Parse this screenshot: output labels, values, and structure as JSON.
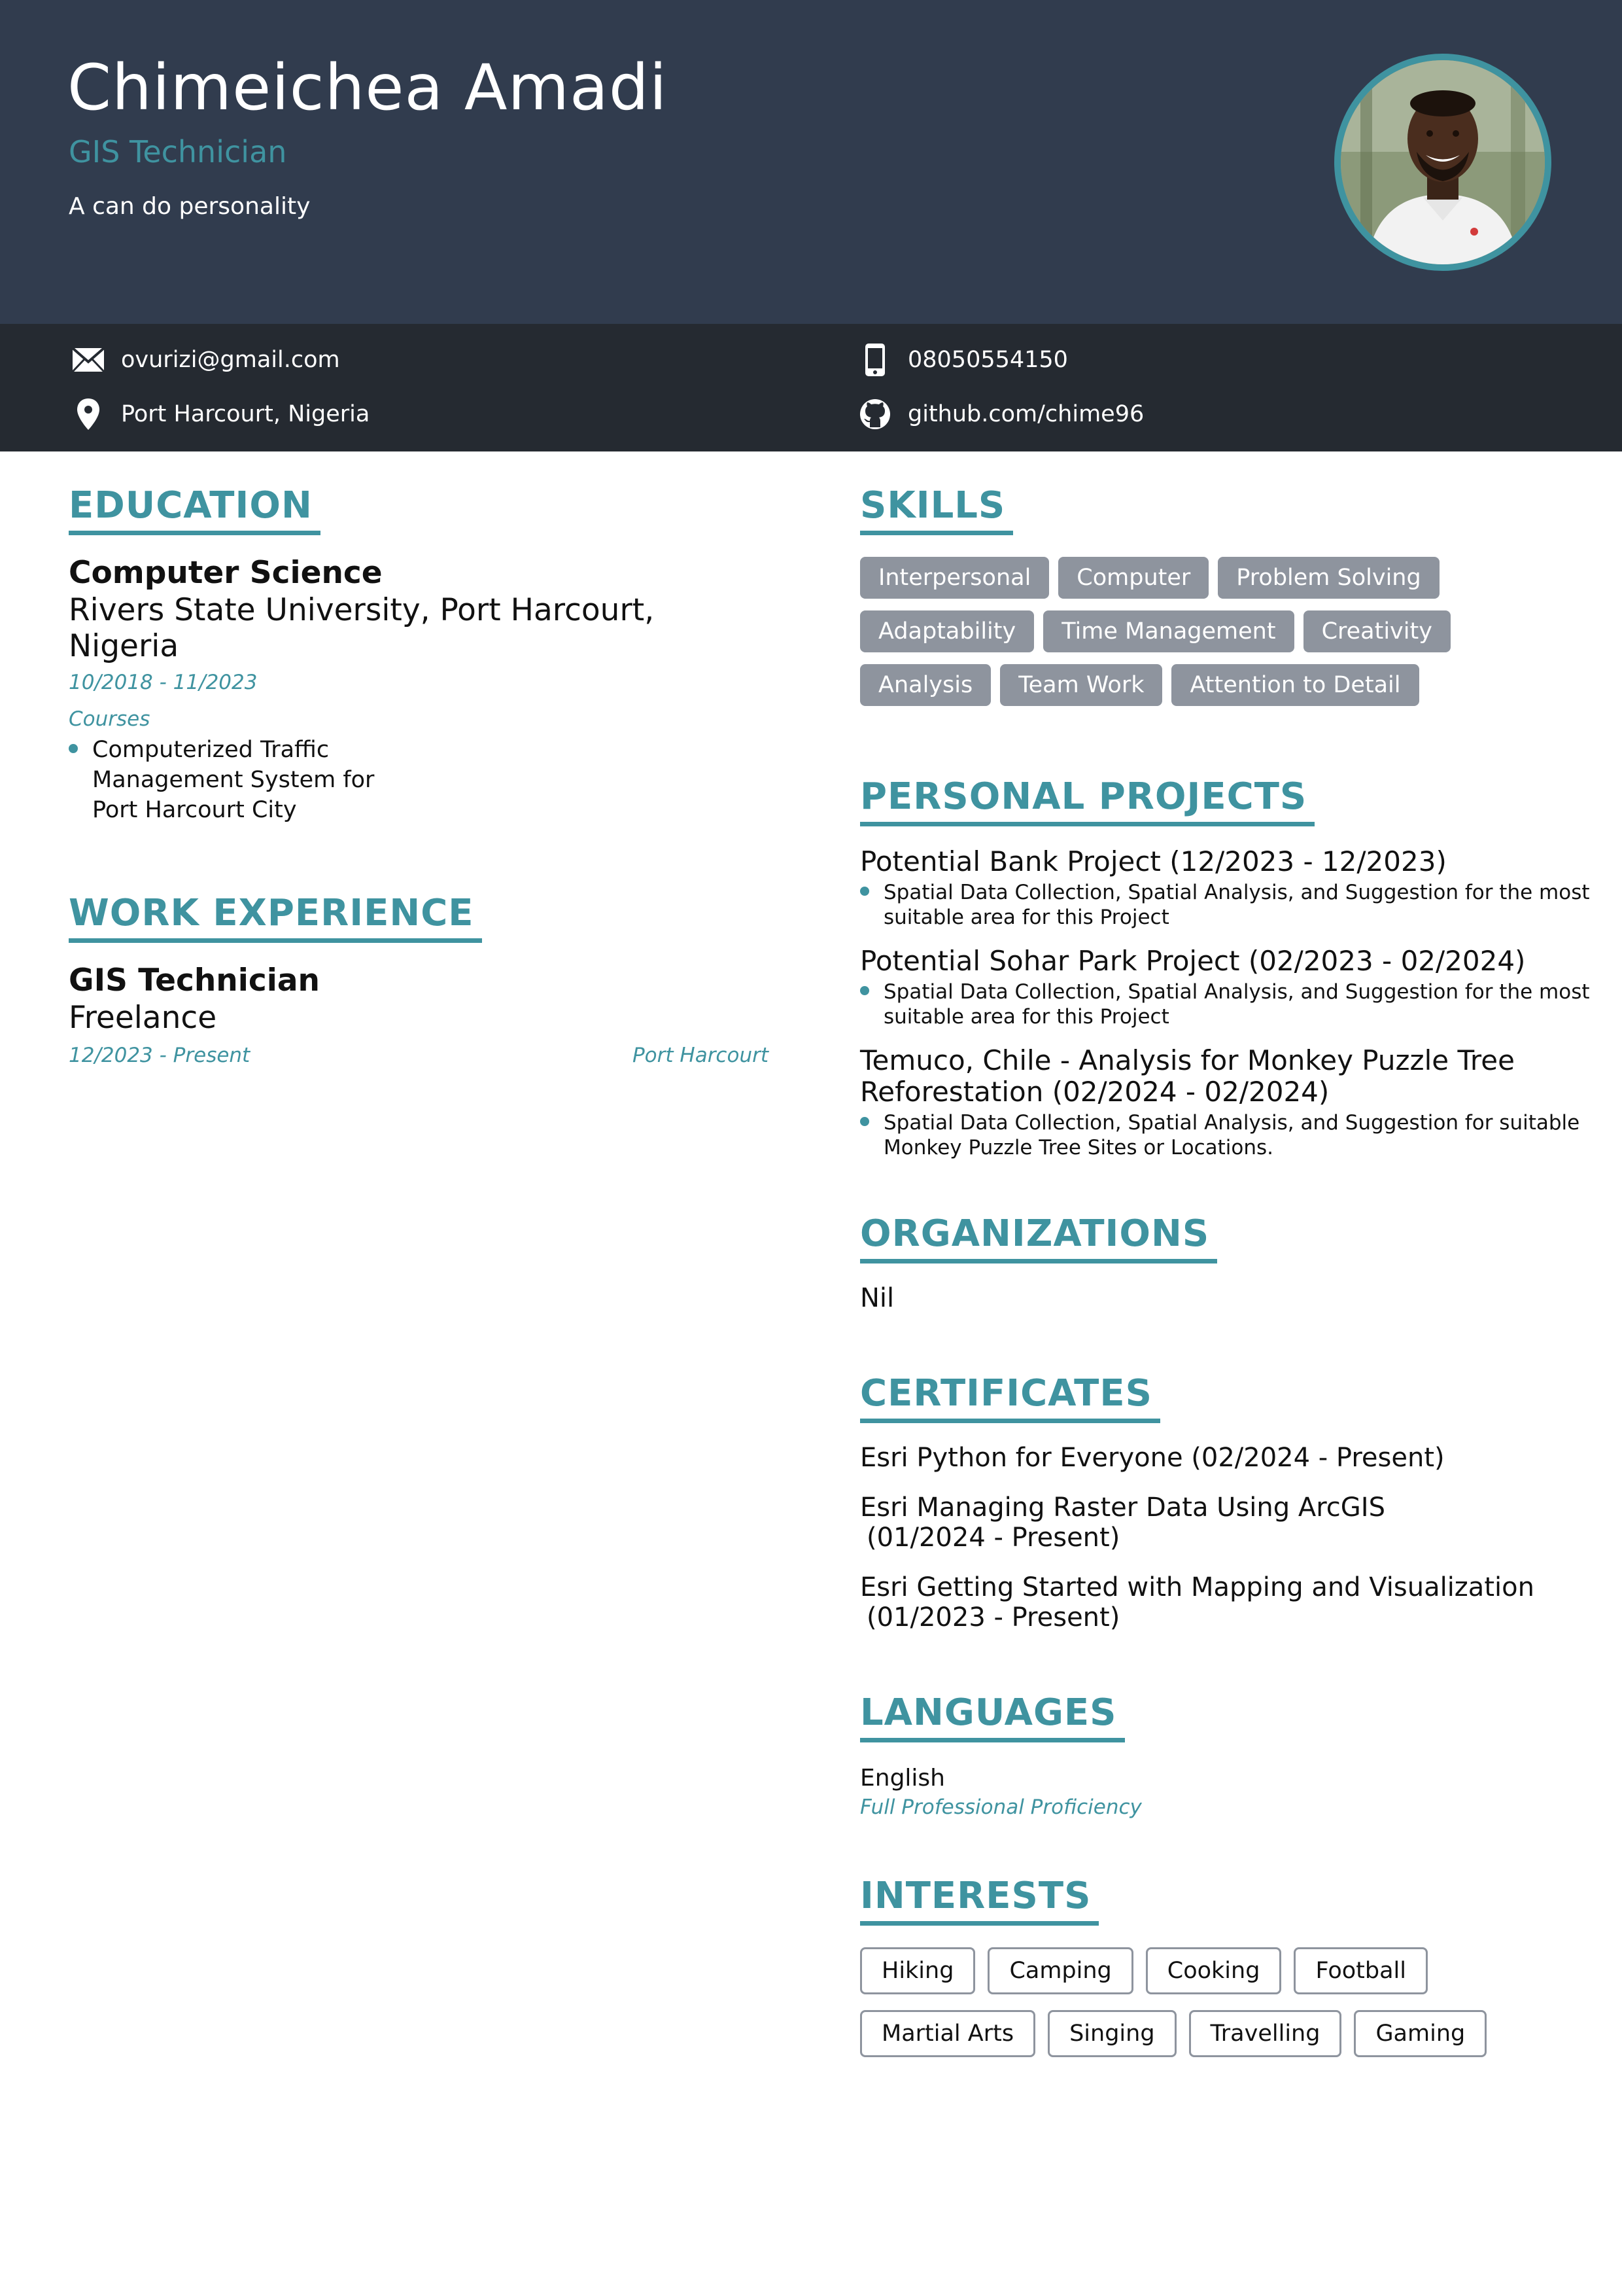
{
  "header": {
    "name": "Chimeichea Amadi",
    "role": "GIS Technician",
    "tagline": "A can do personality"
  },
  "contact": {
    "email": "ovurizi@gmail.com",
    "location": "Port Harcourt, Nigeria",
    "phone": "08050554150",
    "github": "github.com/chime96"
  },
  "education": {
    "title": "EDUCATION",
    "degree": "Computer Science",
    "school": "Rivers State University, Port Harcourt, Nigeria",
    "dates": "10/2018 - 11/2023",
    "courses_label": "Courses",
    "courses": [
      "Computerized Traffic Management System for Port Harcourt City"
    ]
  },
  "work": {
    "title": "WORK EXPERIENCE",
    "role": "GIS Technician",
    "company": "Freelance",
    "dates": "12/2023 - Present",
    "location": "Port Harcourt"
  },
  "skills": {
    "title": "SKILLS",
    "items": [
      "Interpersonal",
      "Computer",
      "Problem Solving",
      "Adaptability",
      "Time Management",
      "Creativity",
      "Analysis",
      "Team Work",
      "Attention to Detail"
    ]
  },
  "projects": {
    "title": "PERSONAL PROJECTS",
    "items": [
      {
        "name": "Potential Bank Project (12/2023 - 12/2023)",
        "desc": "Spatial Data Collection, Spatial Analysis, and Suggestion for the most suitable area for this Project"
      },
      {
        "name": "Potential Sohar Park Project (02/2023 - 02/2024)",
        "desc": "Spatial Data Collection, Spatial Analysis, and Suggestion for the most suitable area for this Project"
      },
      {
        "name": "Temuco, Chile - Analysis for Monkey Puzzle Tree Reforestation (02/2024 - 02/2024)",
        "desc": "Spatial Data Collection, Spatial Analysis, and Suggestion for suitable Monkey Puzzle Tree Sites or Locations."
      }
    ]
  },
  "organizations": {
    "title": "ORGANIZATIONS",
    "text": "Nil"
  },
  "certificates": {
    "title": "CERTIFICATES",
    "items": [
      {
        "line1": "Esri Python for Everyone (02/2024 - Present)",
        "line2": ""
      },
      {
        "line1": "Esri Managing Raster Data Using ArcGIS",
        "line2": "(01/2024 - Present)"
      },
      {
        "line1": "Esri Getting Started with Mapping and Visualization",
        "line2": "(01/2023 - Present)"
      }
    ]
  },
  "languages": {
    "title": "LANGUAGES",
    "name": "English",
    "level": "Full Professional Proficiency"
  },
  "interests": {
    "title": "INTERESTS",
    "items": [
      "Hiking",
      "Camping",
      "Cooking",
      "Football",
      "Martial Arts",
      "Singing",
      "Travelling",
      "Gaming"
    ]
  },
  "colors": {
    "header_bg": "#313c4e",
    "contact_bg": "#252a31",
    "accent": "#3f93a0",
    "pill_bg": "#8e949e"
  },
  "icons": [
    "envelope-icon",
    "location-pin-icon",
    "phone-icon",
    "github-icon"
  ]
}
